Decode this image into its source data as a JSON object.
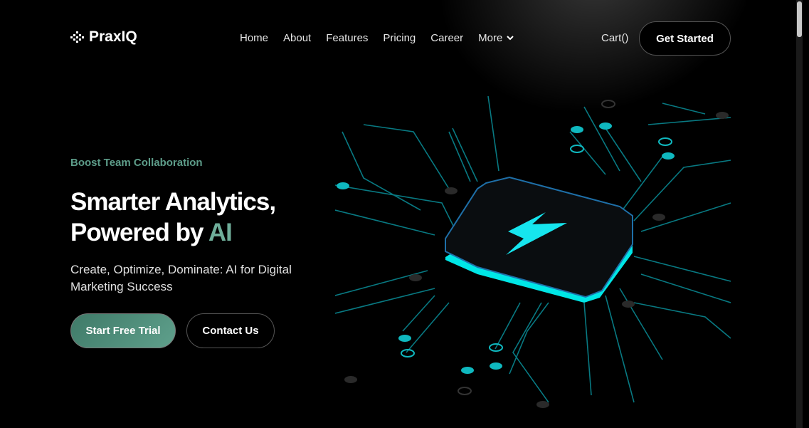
{
  "brand": {
    "name": "PraxIQ",
    "icon": "dotted-diamond-logo"
  },
  "nav": {
    "items": [
      "Home",
      "About",
      "Features",
      "Pricing",
      "Career"
    ],
    "more": "More",
    "cart": "Cart()",
    "cta": "Get Started"
  },
  "hero": {
    "eyebrow": "Boost Team Collaboration",
    "title_line1": "Smarter Analytics,",
    "title_line2_prefix": "Powered by ",
    "title_highlight": "AI",
    "subtitle": "Create, Optimize, Dominate: AI for Digital Marketing Success",
    "primary_button": "Start Free Trial",
    "secondary_button": "Contact Us"
  },
  "colors": {
    "accent": "#5d9c89",
    "circuit": "#0fd0d8",
    "background": "#000000"
  },
  "illustration": {
    "icon": "lightning-bolt-chip"
  }
}
